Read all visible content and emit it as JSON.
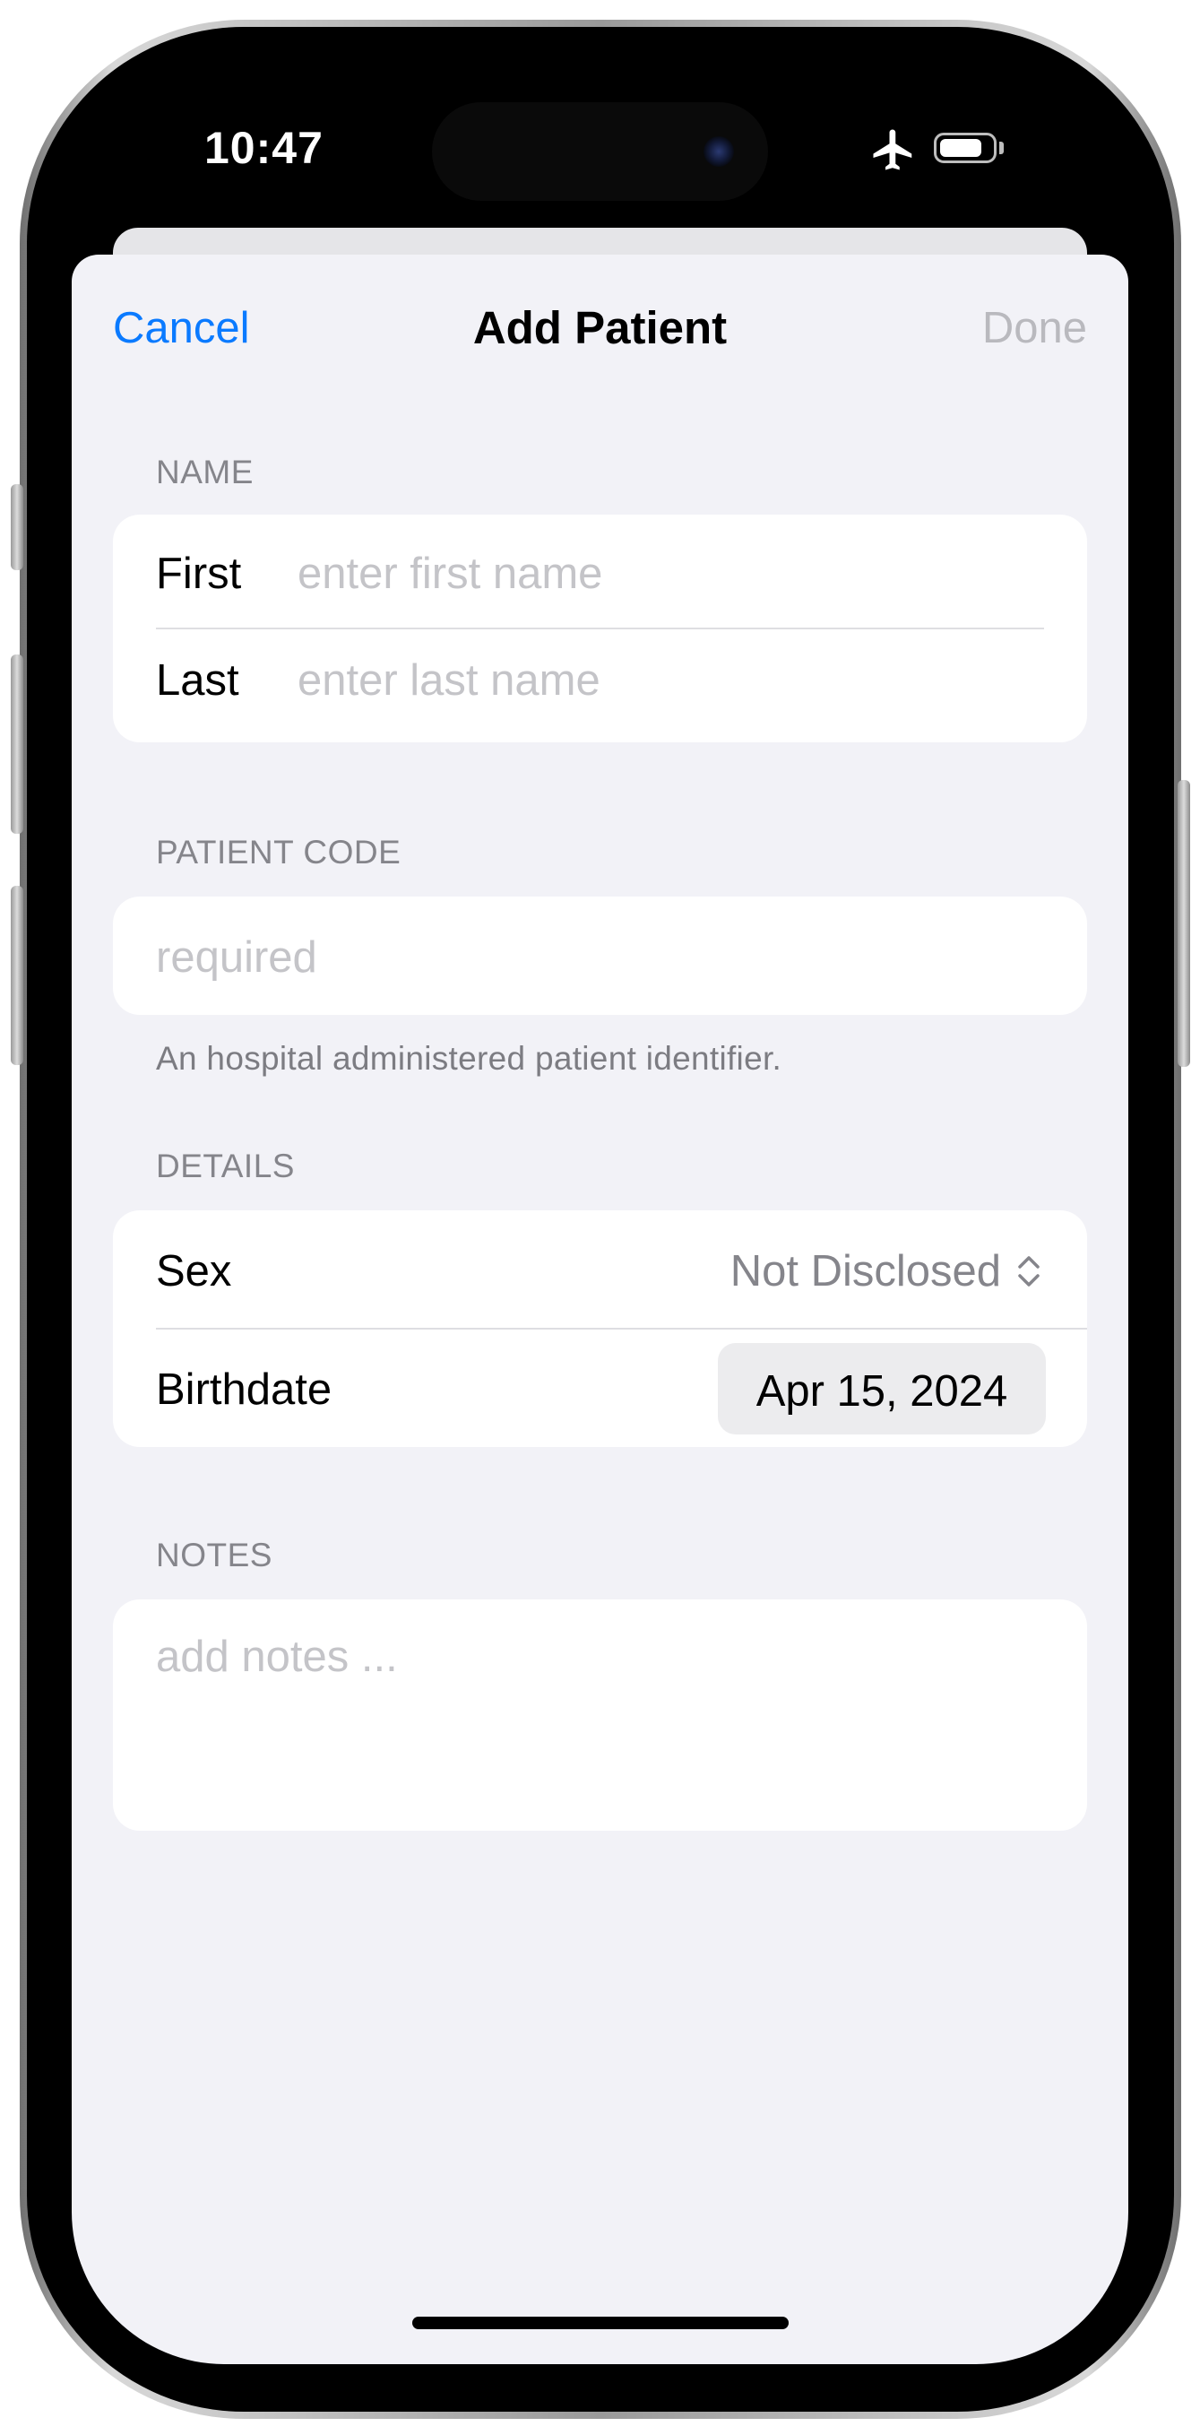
{
  "status_bar": {
    "time": "10:47",
    "icons": [
      "airplane-mode-icon",
      "battery-icon"
    ]
  },
  "nav": {
    "cancel_label": "Cancel",
    "title": "Add Patient",
    "done_label": "Done",
    "accent_color": "#0a7aff"
  },
  "sections": {
    "name": {
      "header": "NAME",
      "first_label": "First",
      "first_placeholder": "enter first name",
      "last_label": "Last",
      "last_placeholder": "enter last name"
    },
    "patient_code": {
      "header": "PATIENT CODE",
      "placeholder": "required",
      "footer": "An hospital administered patient identifier."
    },
    "details": {
      "header": "DETAILS",
      "sex_label": "Sex",
      "sex_value": "Not Disclosed",
      "birthdate_label": "Birthdate",
      "birthdate_value": "Apr 15, 2024"
    },
    "notes": {
      "header": "NOTES",
      "placeholder": "add notes ..."
    }
  }
}
